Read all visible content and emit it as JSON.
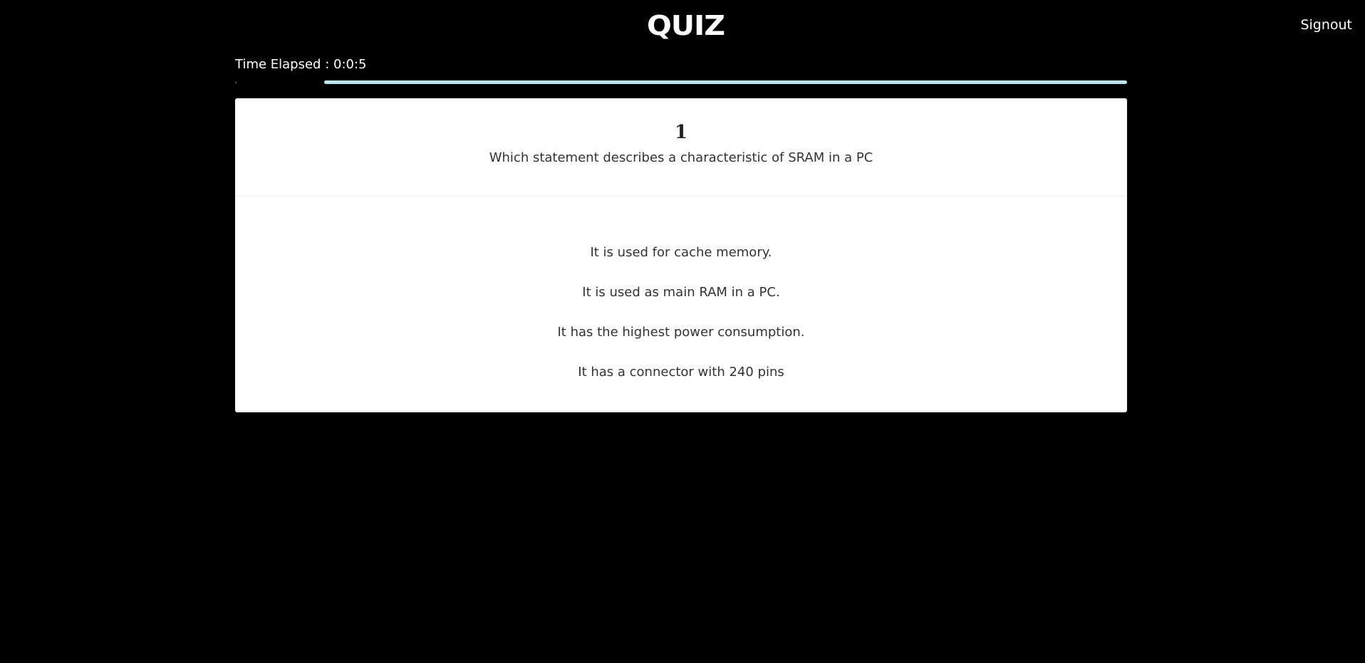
{
  "header": {
    "logo": "QUIZ",
    "signout_label": "Signout"
  },
  "timer": {
    "text": "Time Elapsed : 0:0:5"
  },
  "progress": {
    "fraction": 0.9,
    "color": "#b8e6ee"
  },
  "question": {
    "number": "1",
    "text": "Which statement describes a characteristic of SRAM in a PC",
    "options": [
      "It is used for cache memory.",
      "It is used as main RAM in a PC.",
      "It has the highest power consumption.",
      "It has a connector with 240 pins"
    ]
  }
}
